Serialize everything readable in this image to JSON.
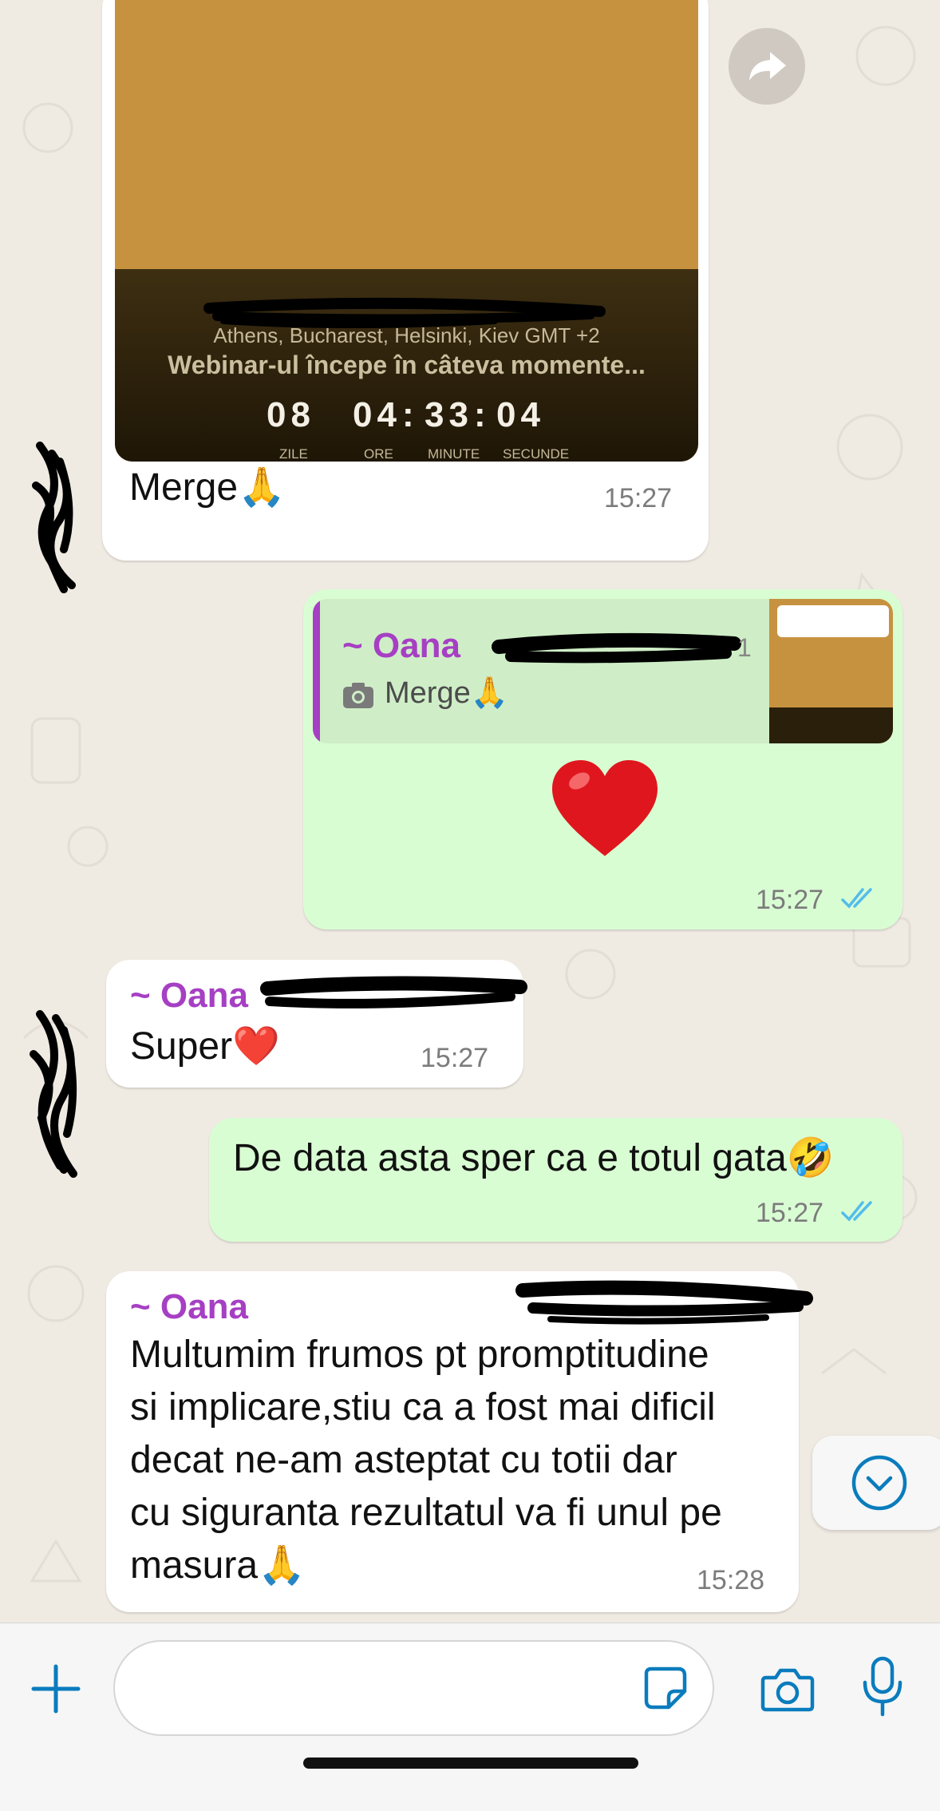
{
  "colors": {
    "background": "#efeae2",
    "incoming_bubble": "#ffffff",
    "outgoing_bubble": "#d9fdd3",
    "sender_name": "#a63fc4",
    "read_ticks": "#53bdeb",
    "accent_icons": "#0a7cbd"
  },
  "messages": [
    {
      "direction": "incoming",
      "image": {
        "timezone": "Athens, Bucharest, Helsinki, Kiev GMT +2",
        "headline": "Webinar-ul începe în câteva momente...",
        "countdown": {
          "days": "08",
          "hours": "04",
          "minutes": "33",
          "seconds": "04",
          "labels": [
            "ZILE",
            "ORE",
            "MINUTE",
            "SECUNDE"
          ]
        }
      },
      "text": "Merge🙏",
      "time": "15:27"
    },
    {
      "direction": "outgoing",
      "reply_to": {
        "sender": "~ Oana",
        "icon": "camera-icon",
        "text": "Merge🙏"
      },
      "text": "❤️",
      "time": "15:27",
      "status": "read"
    },
    {
      "direction": "incoming",
      "sender": "~ Oana",
      "text": "Super❤️",
      "time": "15:27"
    },
    {
      "direction": "outgoing",
      "text": "De data asta sper ca e totul gata🤣",
      "time": "15:27",
      "status": "read"
    },
    {
      "direction": "incoming",
      "sender": "~ Oana",
      "lines": [
        "Multumim frumos pt promptitudine",
        "si implicare,stiu ca a fost mai dificil",
        "decat ne-am asteptat cu totii dar",
        "cu siguranta rezultatul va fi unul pe",
        "masura🙏"
      ],
      "time": "15:28"
    }
  ],
  "input_bar": {
    "icons": [
      "plus-icon",
      "sticker-icon",
      "camera-icon",
      "microphone-icon"
    ]
  },
  "scroll_button_icon": "chevron-down-circle-icon",
  "forward_icon": "forward-icon"
}
